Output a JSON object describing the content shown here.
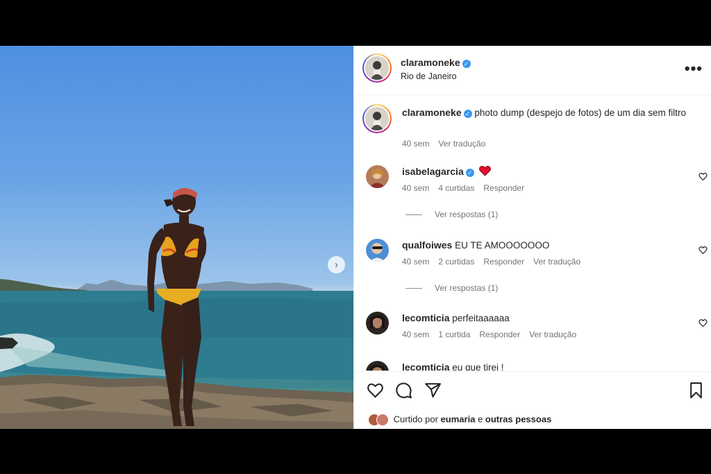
{
  "post": {
    "username": "claramoneke",
    "location": "Rio de Janeiro",
    "more_icon": "more-horizontal-icon",
    "next_icon": "chevron-right-icon"
  },
  "caption": {
    "username": "claramoneke",
    "text": "photo dump (despejo de fotos) de um dia sem filtro",
    "time": "40 sem",
    "translate": "Ver tradução"
  },
  "comments": [
    {
      "username": "isabelagarcia",
      "verified": true,
      "text": "",
      "time": "40 sem",
      "likes": "4 curtidas",
      "reply": "Responder",
      "translate": "",
      "view_replies": "Ver respostas (1)"
    },
    {
      "username": "qualfoiwes",
      "verified": false,
      "text": "EU TE AMOOOOOOO",
      "time": "40 sem",
      "likes": "2 curtidas",
      "reply": "Responder",
      "translate": "Ver tradução",
      "view_replies": "Ver respostas (1)"
    },
    {
      "username": "lecomticia",
      "verified": false,
      "text": "perfeitaaaaaa",
      "time": "40 sem",
      "likes": "1 curtida",
      "reply": "Responder",
      "translate": "Ver tradução",
      "view_replies": ""
    },
    {
      "username": "lecomticia",
      "verified": false,
      "text": "eu que tirei !",
      "time": "",
      "likes": "",
      "reply": "",
      "translate": "",
      "view_replies": ""
    }
  ],
  "actions": {
    "like_icon": "heart-icon",
    "comment_icon": "comment-icon",
    "share_icon": "send-icon",
    "save_icon": "bookmark-icon"
  },
  "liked_by": {
    "prefix": "Curtido por",
    "user": "eumaria",
    "connector": "e",
    "others": "outras pessoas"
  },
  "colors": {
    "verified": "#3897f0",
    "heart_emoji": "#e0102a",
    "meta_text": "#737373"
  }
}
